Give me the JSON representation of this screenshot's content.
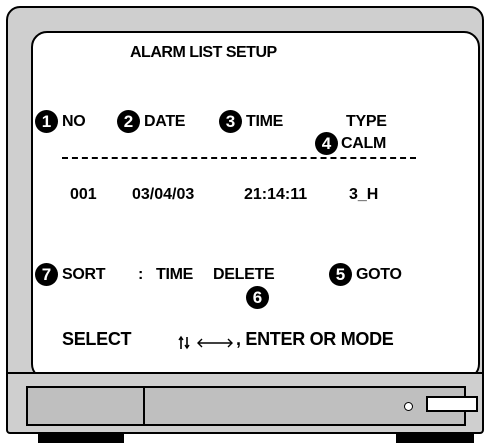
{
  "screen": {
    "title": "ALARM LIST SETUP",
    "columns": [
      {
        "badge": "1",
        "label": "NO"
      },
      {
        "badge": "2",
        "label": "DATE"
      },
      {
        "badge": "3",
        "label": "TIME"
      },
      {
        "badge": "4",
        "label_top": "TYPE",
        "label": "CALM"
      }
    ],
    "row": {
      "no": "001",
      "date": "03/04/03",
      "time": "21:14:11",
      "type": "3_H"
    },
    "sort": {
      "badge": "7",
      "label": "SORT",
      "sep": ":",
      "value": "TIME"
    },
    "delete": {
      "badge": "6",
      "label": "DELETE"
    },
    "goto": {
      "badge": "5",
      "label": "GOTO"
    },
    "hint": {
      "prefix": "SELECT",
      "suffix": ", ENTER OR MODE"
    }
  },
  "icons": [
    "up-down-arrows-icon",
    "left-right-arrow-icon"
  ]
}
